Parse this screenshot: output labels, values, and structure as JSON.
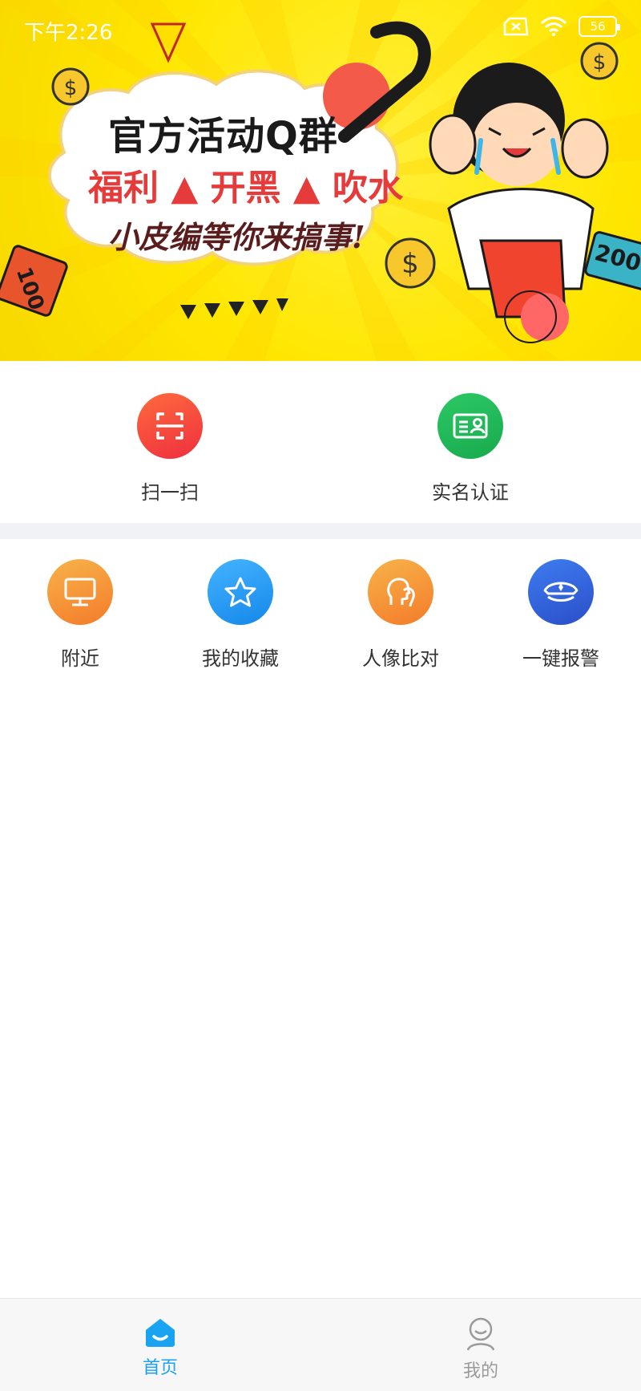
{
  "status_bar": {
    "time": "下午2:26",
    "battery": "56"
  },
  "banner": {
    "title": "官方活动Q群",
    "line2": "福利 ▲ 开黑 ▲ 吹水",
    "line3": "小皮编等你来搞事!",
    "money_tag_left": "100",
    "money_tag_right": "200"
  },
  "top_actions": [
    {
      "label": "扫一扫",
      "icon": "scan-icon",
      "color": "#f2453d"
    },
    {
      "label": "实名认证",
      "icon": "id-card-icon",
      "color": "#1fbd5a"
    }
  ],
  "grid_actions": [
    {
      "label": "附近",
      "icon": "monitor-icon",
      "color": "#f5933a"
    },
    {
      "label": "我的收藏",
      "icon": "star-icon",
      "color": "#2b9cf2"
    },
    {
      "label": "人像比对",
      "icon": "face-compare-icon",
      "color": "#f5933a"
    },
    {
      "label": "一键报警",
      "icon": "police-cap-icon",
      "color": "#3366dd"
    }
  ],
  "bottom_nav": [
    {
      "label": "首页",
      "icon": "home-icon",
      "active": true,
      "color": "#1aa3f0"
    },
    {
      "label": "我的",
      "icon": "user-icon",
      "active": false,
      "color": "#9a9a9a"
    }
  ]
}
